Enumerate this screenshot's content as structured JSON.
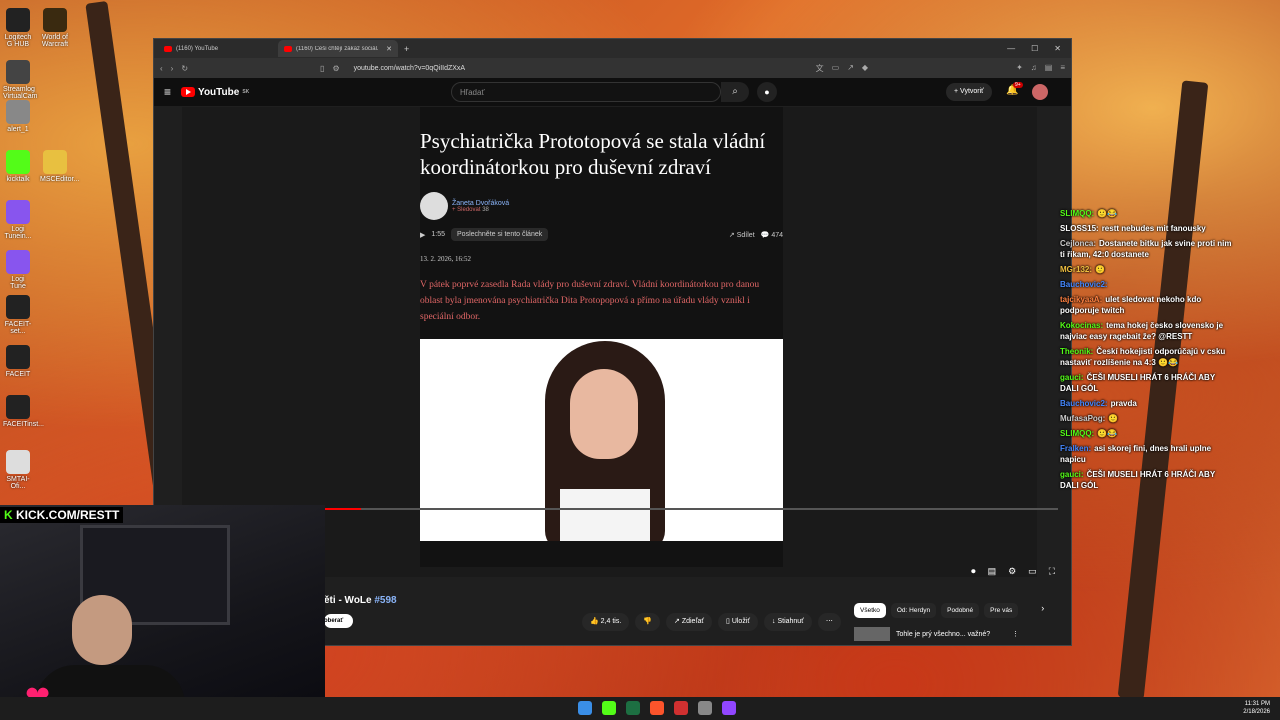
{
  "desktop": {
    "icons": [
      {
        "label": "Logitech G HUB",
        "color": "#222"
      },
      {
        "label": "World of Warcraft",
        "color": "#3a2a10"
      },
      {
        "label": "Streamlog VirtualCam",
        "color": "#444"
      },
      {
        "label": "alert_1",
        "color": "#888"
      },
      {
        "label": "kicktalk",
        "color": "#53fc18"
      },
      {
        "label": "MSCEditor...",
        "color": "#e8c040"
      },
      {
        "label": "Logi Tunein...",
        "color": "#8855ee"
      },
      {
        "label": "Logi Tune",
        "color": "#8855ee"
      },
      {
        "label": "FACEIT-set...",
        "color": "#222"
      },
      {
        "label": "FACEIT",
        "color": "#222"
      },
      {
        "label": "FACEITinst...",
        "color": "#222"
      },
      {
        "label": "SMTAI-Ofi...",
        "color": "#ddd"
      }
    ]
  },
  "browser": {
    "tabs": [
      {
        "label": "(1160) YouTube",
        "active": false
      },
      {
        "label": "(1160) Češi chtějí zákaz sociál...",
        "active": true
      }
    ],
    "url": "youtube.com/watch?v=0qQiIIdZXxA"
  },
  "youtube": {
    "logo": "YouTube",
    "logo_region": "SK",
    "search_placeholder": "Hľadať",
    "create_label": "Vytvoriť",
    "notif_badge": "9+",
    "article": {
      "title": "Psychiatrička Prototopová se stala vládní koordinátorkou pro duševní zdraví",
      "author": "Žaneta Dvořáková",
      "follow": "+ Sledovat",
      "followers": "38",
      "audio_duration": "1:55",
      "listen_label": "Poslechněte si tento článek",
      "share_label": "Sdílet",
      "comments": "474",
      "date": "13. 2. 2026, 16:52",
      "lead": "V pátek poprvé zasedla Rada vlády pro duševní zdraví. Vládní koordinátorkou pro danou oblast byla jmenována psychiatrička Dita Protopopová a přímo na úřadu vlády vznikl i speciální odbor."
    },
    "progress": 0.05,
    "video_title_prefix": "ěti - WoLe",
    "video_title_tag": "#598",
    "subscribe": "oberať",
    "actions": {
      "likes": "2,4 tis.",
      "share": "Zdieľať",
      "save": "Uložiť",
      "download": "Stiahnuť"
    },
    "chips": [
      "Všetko",
      "Od: Herdyn",
      "Podobné",
      "Pre vás"
    ],
    "rec_title": "Tohle je prý všechno... važné?"
  },
  "chat": [
    {
      "user": "SLIMQQ:",
      "color": "#53fc18",
      "text": "🙂😂"
    },
    {
      "user": "SLOSS15:",
      "color": "#ffffff",
      "text": "restt nebudes mit fanousky"
    },
    {
      "user": "Cejlonca:",
      "color": "#cccccc",
      "text": "Dostanete bitku jak svine proti nim ti řikam, 42:0 dostanete"
    },
    {
      "user": "MGr132:",
      "color": "#f0c040",
      "text": "🙂"
    },
    {
      "user": "Bauchovic2:",
      "color": "#4488ff",
      "text": ""
    },
    {
      "user": "tajcikyaaA:",
      "color": "#ff8040",
      "text": "ulet sledovat nekoho kdo podporuje twitch"
    },
    {
      "user": "Kokocinas:",
      "color": "#53fc18",
      "text": "tema hokej česko slovensko je najviac easy ragebait že? @RESTT"
    },
    {
      "user": "Theonik:",
      "color": "#53fc18",
      "text": "Českí hokejisti odporúčajú v csku nastaviť rozlíšenie na 4:3 🙂😂"
    },
    {
      "user": "gauci:",
      "color": "#53fc18",
      "text": "ČEŠI MUSELI HRÁT 6 HRÁČI ABY DALI GÓL"
    },
    {
      "user": "Bauchovic2:",
      "color": "#4488ff",
      "text": "pravda"
    },
    {
      "user": "MufasaPog:",
      "color": "#cccccc",
      "text": "🙂"
    },
    {
      "user": "SLIMQQ:",
      "color": "#53fc18",
      "text": "🙂😂"
    },
    {
      "user": "Fralken:",
      "color": "#4488ff",
      "text": "asi skorej fini, dnes hrali uplne napicu"
    },
    {
      "user": "gauci:",
      "color": "#53fc18",
      "text": "ČEŠI MUSELI HRÁT 6 HRÁČI ABY DALI GÓL"
    }
  ],
  "kick_banner": {
    "prefix": "K",
    "text": "KICK.COM/RESTT"
  },
  "taskbar": {
    "time": "11:31 PM",
    "date": "2/18/2026"
  }
}
